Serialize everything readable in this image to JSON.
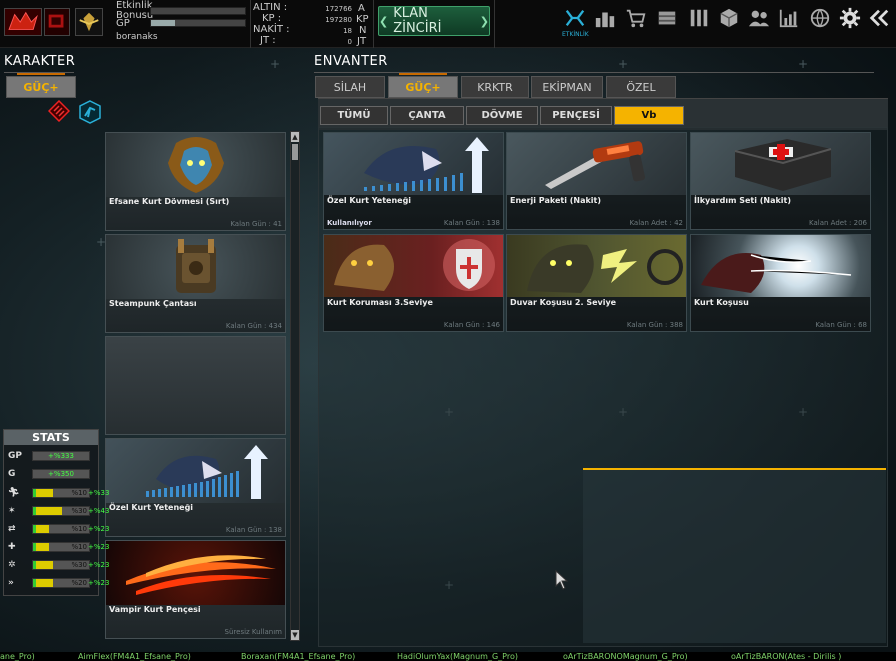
{
  "topbar": {
    "stats": {
      "etkinlik_label": "Etkinlik Bonusu",
      "gp_label": "GP",
      "username": "boranaks",
      "altin_label": "ALTIN :",
      "kp_label": "KP :",
      "nakit_label": "NAKİT :",
      "jt_label": "JT :",
      "altin_value": "172766",
      "kp_value": "197280",
      "nakit_value": "18",
      "jt_value": "0",
      "altin_unit": "A",
      "kp_unit": "KP",
      "nakit_unit": "N",
      "jt_unit": "JT",
      "etkinlik_progress": 0,
      "gp_progress": 0.25
    },
    "klan_button": "KLAN ZİNCİRİ",
    "icons": [
      "etkinlik-icon",
      "ranking-icon",
      "shop-icon",
      "inventory-icon",
      "clan-icon",
      "box-icon",
      "friends-icon",
      "stats-icon",
      "globe-icon",
      "settings-icon",
      "back-icon"
    ],
    "etkinlik_label": "ETKİNLİK"
  },
  "karakter": {
    "title": "KARAKTER",
    "tab": "GÜÇ+",
    "items": [
      {
        "name": "Efsane Kurt Dövmesi (Sırt)",
        "sub": "Kalan Gün : 41"
      },
      {
        "name": "Steampunk Çantası",
        "sub": "Kalan Gün : 434"
      },
      {
        "name": "",
        "sub": ""
      },
      {
        "name": "Özel Kurt Yeteneği",
        "sub": "Kalan Gün : 138"
      },
      {
        "name": "Vampir Kurt Pençesi",
        "sub": "Süresiz Kullanım"
      }
    ]
  },
  "stats": {
    "title": "STATS",
    "rows": [
      {
        "icon": "GP",
        "text": "+%333",
        "bonus": ""
      },
      {
        "icon": "G",
        "text": "+%350",
        "bonus": ""
      },
      {
        "icon": "run-icon",
        "text": "%10",
        "bonus": "+%33",
        "fill": 0.2
      },
      {
        "icon": "claw-icon",
        "text": "%30",
        "bonus": "+%43",
        "fill": 0.35
      },
      {
        "icon": "swap-icon",
        "text": "%10",
        "bonus": "+%23",
        "fill": 0.15
      },
      {
        "icon": "heal-icon",
        "text": "%10",
        "bonus": "+%23",
        "fill": 0.15
      },
      {
        "icon": "shield-icon",
        "text": "%30",
        "bonus": "+%23",
        "fill": 0.3
      },
      {
        "icon": "dash-icon",
        "text": "%20",
        "bonus": "+%23",
        "fill": 0.25
      }
    ]
  },
  "envanter": {
    "title": "ENVANTER",
    "tabs": [
      "SİLAH",
      "GÜÇ+",
      "KRKTR",
      "EKİPMAN",
      "ÖZEL"
    ],
    "active_tab": "GÜÇ+",
    "subtabs": [
      "TÜMÜ",
      "ÇANTA",
      "DÖVME",
      "PENÇESİ",
      "Vb"
    ],
    "active_subtab": "Vb",
    "items": [
      {
        "name": "Özel Kurt Yeteneği",
        "sub": "Kalan Gün : 138",
        "status": "Kullanılıyor"
      },
      {
        "name": "Enerji Paketi (Nakit)",
        "sub": "Kalan Adet : 42",
        "status": ""
      },
      {
        "name": "İlkyardım Seti (Nakit)",
        "sub": "Kalan Adet : 206",
        "status": ""
      },
      {
        "name": "Kurt Koruması 3.Seviye",
        "sub": "Kalan Gün : 146",
        "status": ""
      },
      {
        "name": "Duvar Koşusu 2. Seviye",
        "sub": "Kalan Gün : 388",
        "status": ""
      },
      {
        "name": "Kurt Koşusu",
        "sub": "Kalan Gün : 68",
        "status": ""
      }
    ]
  },
  "ticker": [
    "ane_Pro)",
    "AimFlex(FM4A1_Efsane_Pro)",
    "Boraxan(FM4A1_Efsane_Pro)",
    "HadiOlumYax(Magnum_G_Pro)",
    "oArTizBARONOMagnum_G_Pro)",
    "oArTizBARON(Ates - Dirilis )"
  ],
  "colors": {
    "accent": "#f5b300",
    "green": "#3fa06a",
    "bonus": "#44ff44"
  }
}
